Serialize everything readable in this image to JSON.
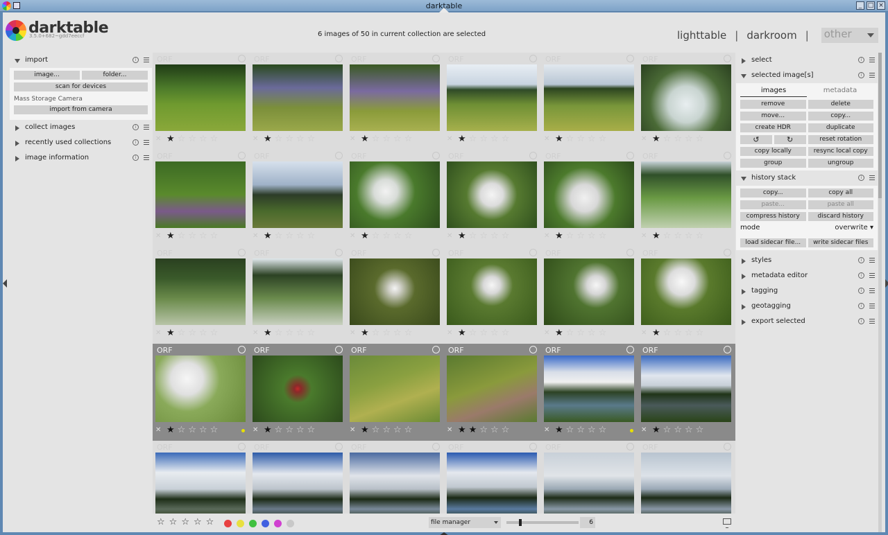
{
  "window": {
    "title": "darktable",
    "controls": [
      "_",
      "□",
      "×"
    ]
  },
  "header": {
    "brand": "darktable",
    "version": "3.5.0+682~gdd7eeccf",
    "status": "6 images of 50 in current collection are selected",
    "views": {
      "lighttable": "lighttable",
      "separator": "|",
      "darkroom": "darkroom",
      "other": "other"
    }
  },
  "left_panel": {
    "import": {
      "title": "import",
      "image_button": "image...",
      "folder_button": "folder...",
      "scan_button": "scan for devices",
      "camera_label": "Mass Storage Camera",
      "import_camera_button": "import from camera"
    },
    "modules": [
      {
        "title": "collect images"
      },
      {
        "title": "recently used collections"
      },
      {
        "title": "image information"
      }
    ]
  },
  "lighttable": {
    "rows": [
      [
        {
          "ext": "ORF",
          "stars": 1,
          "selected": false,
          "bg": "linear-gradient(180deg,#1f3b16 0%,#4c7a2a 35%,#6f9a2f 60%,#8aa83a 100%)"
        },
        {
          "ext": "ORF",
          "stars": 1,
          "selected": false,
          "bg": "linear-gradient(180deg,#2a4a1e 0%,#6a6a9a 35%,#7b8f3a 65%,#9aa84a 100%)"
        },
        {
          "ext": "ORF",
          "stars": 1,
          "selected": false,
          "bg": "linear-gradient(180deg,#3a5a22 0%,#7a6aa0 40%,#8a9b3a 70%,#a8b050 100%)"
        },
        {
          "ext": "ORF",
          "stars": 1,
          "selected": false,
          "bg": "linear-gradient(180deg,#e8eef4 0%,#c8d4e0 30%,#2f4a28 38%,#6e8f34 60%,#a6b04c 100%)"
        },
        {
          "ext": "ORF",
          "stars": 1,
          "selected": false,
          "bg": "linear-gradient(180deg,#e2e8ee 0%,#b8c6d4 30%,#2c4420 36%,#78963a 62%,#a8ae48 100%)"
        },
        {
          "ext": "ORF",
          "stars": 1,
          "selected": false,
          "bg": "radial-gradient(circle at 50% 60%,#e8eef0 0%,#c8d4d0 30%,#4a6a36 60%,#2a4020 100%)"
        }
      ],
      [
        {
          "ext": "ORF",
          "stars": 1,
          "selected": false,
          "bg": "linear-gradient(180deg,#3c6a24 0%,#5a8a2c 50%,#7a5a8a 75%,#4a7a24 100%)"
        },
        {
          "ext": "ORF",
          "stars": 1,
          "selected": false,
          "bg": "linear-gradient(180deg,#d6e0ec 0%,#9fb2c8 35%,#2c3c28 50%,#4a6a2c 75%,#6a7a3a 100%)"
        },
        {
          "ext": "ORF",
          "stars": 1,
          "selected": false,
          "bg": "radial-gradient(circle at 40% 45%,#f2f2f2 0%,#d8dcd8 18%,#4a7a2c 45%,#2c4c1c 100%)"
        },
        {
          "ext": "ORF",
          "stars": 1,
          "selected": false,
          "bg": "radial-gradient(circle at 50% 50%,#f4f4f4 0%,#dcdcdc 20%,#567a30 45%,#30501e 100%)"
        },
        {
          "ext": "ORF",
          "stars": 1,
          "selected": false,
          "bg": "radial-gradient(circle at 45% 55%,#f0f0f0 0%,#d8d8d8 22%,#4c7a2c 50%,#2c4a1c 100%)"
        },
        {
          "ext": "ORF",
          "stars": 1,
          "selected": false,
          "bg": "linear-gradient(180deg,#c8d2d8 0%,#30502a 20%,#6a9a44 55%,#c0d0b0 100%)"
        }
      ],
      [
        {
          "ext": "ORF",
          "stars": 1,
          "selected": false,
          "bg": "linear-gradient(180deg,#2a4020 0%,#3a5a2a 30%,#6a8a4a 60%,#b8c4a8 100%)"
        },
        {
          "ext": "ORF",
          "stars": 1,
          "selected": false,
          "bg": "linear-gradient(180deg,#e0e8ec 0%,#2c4224 25%,#6a8a4c 60%,#c8d0c0 100%)"
        },
        {
          "ext": "ORF",
          "stars": 1,
          "selected": false,
          "bg": "radial-gradient(circle at 50% 45%,#f4f4f4 0%,#d0d0c8 10%,#5a6a2c 35%,#3a4a1c 100%)"
        },
        {
          "ext": "ORF",
          "stars": 1,
          "selected": false,
          "bg": "radial-gradient(circle at 50% 40%,#f6f6f6 0%,#d8d8d8 14%,#5a7a30 35%,#3a5a1c 100%)"
        },
        {
          "ext": "ORF",
          "stars": 1,
          "selected": false,
          "bg": "radial-gradient(circle at 58% 40%,#f6f6f6 0%,#d6d6d6 14%,#507430 35%,#2e4a18 100%)"
        },
        {
          "ext": "ORF",
          "stars": 1,
          "selected": false,
          "bg": "radial-gradient(circle at 45% 35%,#f8f8f8 0%,#dcdcdc 20%,#5a7a2c 42%,#3a5a1a 100%)"
        }
      ],
      [
        {
          "ext": "ORF",
          "stars": 1,
          "selected": true,
          "dot": true,
          "bg": "radial-gradient(circle at 35% 35%,#f6f6f6 0%,#e0e0e0 22%,#8aaa5a 45%,#6a8a3a 100%)"
        },
        {
          "ext": "ORF",
          "stars": 1,
          "selected": true,
          "dot": false,
          "bg": "radial-gradient(circle at 50% 50%,#c22a2a 0%,#8a2a2a 6%,#4a7a2c 25%,#2c4a1c 100%)"
        },
        {
          "ext": "ORF",
          "stars": 1,
          "selected": true,
          "dot": false,
          "bg": "linear-gradient(160deg,#6a8a3a 0%,#8aa040 40%,#b0b050 65%,#6a8a34 100%)"
        },
        {
          "ext": "ORF",
          "stars": 2,
          "selected": true,
          "dot": false,
          "bg": "linear-gradient(160deg,#5a7a30 0%,#8a9a3c 45%,#9a7a6a 70%,#5a7a30 100%)"
        },
        {
          "ext": "ORF",
          "stars": 1,
          "selected": true,
          "dot": true,
          "bg": "linear-gradient(180deg,#3a6ac8 0%,#d8dee8 25%,#f0f0f0 40%,#2c4224 55%,#5a7a8a 75%,#3a5a24 100%)"
        },
        {
          "ext": "ORF",
          "stars": 1,
          "selected": true,
          "dot": false,
          "bg": "linear-gradient(180deg,#3a6ac0 0%,#e0e6ee 30%,#c8d0d8 45%,#203418 58%,#4a5a5a 75%,#2a4418 100%)"
        }
      ],
      [
        {
          "ext": "ORF",
          "stars": 1,
          "selected": false,
          "bg": "linear-gradient(180deg,#3a6ab8 0%,#e8ecf0 30%,#c8d0d8 55%,#1e2e18 70%,#5a6a5a 85%,#2a3a1a 100%)"
        },
        {
          "ext": "ORF",
          "stars": 1,
          "selected": false,
          "bg": "linear-gradient(180deg,#2c5aa8 0%,#e4e8ee 32%,#bcc4cc 55%,#1c2a16 70%,#6a7a8a 85%,#22321a 100%)"
        },
        {
          "ext": "ORF",
          "stars": 1,
          "selected": false,
          "bg": "linear-gradient(180deg,#4a6aa0 0%,#e0e4ea 35%,#b8c0c8 55%,#1c2a16 70%,#7a8a9a 85%,#22321a 100%)"
        },
        {
          "ext": "ORF",
          "stars": 1,
          "selected": false,
          "bg": "linear-gradient(180deg,#2a5ab0 0%,#e4e8ee 30%,#c0c8d0 52%,#1a2814 68%,#5a7aa0 85%,#1e3018 100%)"
        },
        {
          "ext": "ORF",
          "stars": 1,
          "selected": false,
          "bg": "linear-gradient(180deg,#c8d0d8 0%,#e0e4e8 35%,#9aa8b4 55%,#1e2c18 68%,#8a9aa8 85%,#22321a 100%)"
        },
        {
          "ext": "ORF",
          "stars": 1,
          "selected": false,
          "bg": "linear-gradient(180deg,#b8c4d0 0%,#dce2e8 35%,#9aa8b6 55%,#1c2a16 68%,#8a98a8 85%,#203018 100%)"
        }
      ]
    ]
  },
  "bottom_bar": {
    "stars": [
      "☆",
      "☆",
      "☆",
      "☆",
      "☆"
    ],
    "color_labels": [
      "#e84040",
      "#e8e040",
      "#40c040",
      "#4060e0",
      "#d040d0",
      "#c8c8c8"
    ],
    "layout": "file manager",
    "zoom": "6"
  },
  "right_panel": {
    "select": {
      "title": "select"
    },
    "selected_images": {
      "title": "selected image[s]",
      "tab_images": "images",
      "tab_metadata": "metadata",
      "buttons": [
        {
          "label": "remove",
          "dim": false
        },
        {
          "label": "delete",
          "dim": false
        },
        {
          "label": "move...",
          "dim": false
        },
        {
          "label": "copy...",
          "dim": false
        },
        {
          "label": "create HDR",
          "dim": false
        },
        {
          "label": "duplicate",
          "dim": false
        },
        {
          "label": "↺",
          "dim": false,
          "split": true,
          "second": "↻"
        },
        {
          "label": "reset rotation",
          "dim": false
        },
        {
          "label": "copy locally",
          "dim": false
        },
        {
          "label": "resync local copy",
          "dim": false
        },
        {
          "label": "group",
          "dim": false
        },
        {
          "label": "ungroup",
          "dim": false
        }
      ]
    },
    "history_stack": {
      "title": "history stack",
      "copy": "copy...",
      "copy_all": "copy all",
      "paste": "paste...",
      "paste_all": "paste all",
      "compress": "compress history",
      "discard": "discard history",
      "mode_label": "mode",
      "mode_value": "overwrite",
      "load_sidecar": "load sidecar file...",
      "write_sidecar": "write sidecar files"
    },
    "modules": [
      {
        "title": "styles"
      },
      {
        "title": "metadata editor"
      },
      {
        "title": "tagging"
      },
      {
        "title": "geotagging"
      },
      {
        "title": "export selected"
      }
    ]
  }
}
